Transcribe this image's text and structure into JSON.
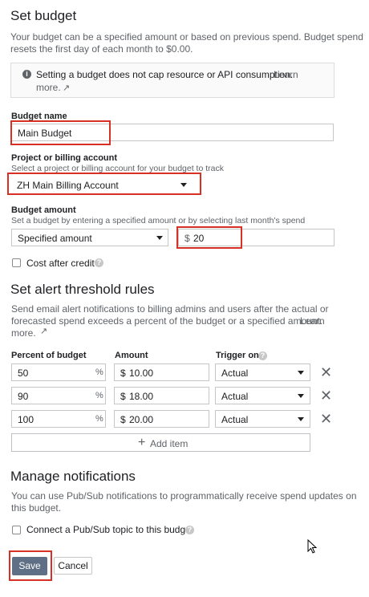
{
  "budget": {
    "title": "Set budget",
    "desc_line1": "Your budget can be a specified amount or based on previous spend. Budget spend",
    "desc_line2": "resets the first day of each month to $0.00.",
    "info_line1": "Setting a budget does not cap resource or API consumption.",
    "info_learn1": "Learn",
    "info_learn2": "more.",
    "name_label": "Budget name",
    "name_value": "Main Budget",
    "project_label": "Project or billing account",
    "project_help": "Select a project or billing account for your budget to track",
    "project_value": "ZH Main Billing Account",
    "amount_label": "Budget amount",
    "amount_help": "Set a budget by entering a specified amount or by selecting last month's spend",
    "amount_type": "Specified amount",
    "amount_currency": "$",
    "amount_value": "20",
    "cost_after_credit": "Cost after credit"
  },
  "alerts": {
    "title": "Set alert threshold rules",
    "desc_line1": "Send email alert notifications to billing admins and users after the actual or",
    "desc_line2": "forecasted spend exceeds a percent of the budget or a specified amount.",
    "desc_learn": "Learn",
    "desc_more": "more.",
    "col_percent": "Percent of budget",
    "col_amount": "Amount",
    "col_trigger": "Trigger on",
    "pct_symbol": "%",
    "currency": "$",
    "rows": [
      {
        "percent": "50",
        "amount": "10.00",
        "trigger": "Actual"
      },
      {
        "percent": "90",
        "amount": "18.00",
        "trigger": "Actual"
      },
      {
        "percent": "100",
        "amount": "20.00",
        "trigger": "Actual"
      }
    ],
    "add_item": "Add item"
  },
  "notifications": {
    "title": "Manage notifications",
    "desc_line1": "You can use Pub/Sub notifications to programmatically receive spend updates on",
    "desc_line2": "this budget.",
    "pubsub_label": "Connect a Pub/Sub topic to this budget"
  },
  "actions": {
    "save": "Save",
    "cancel": "Cancel"
  },
  "colors": {
    "highlight": "#d93025",
    "save_bg": "#5f6f86"
  }
}
